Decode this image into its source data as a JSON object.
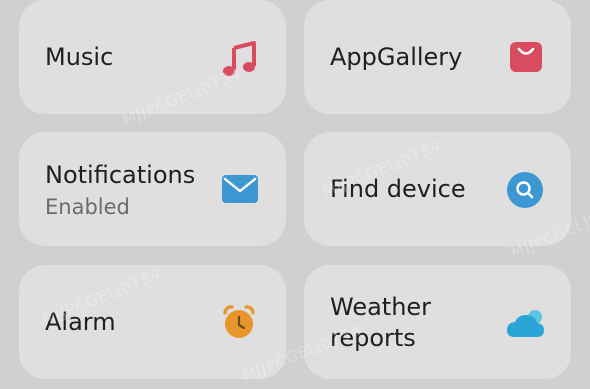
{
  "watermark_text": "MJJPCGELJb754",
  "tiles": {
    "music": {
      "label": "Music",
      "icon": "music-note-icon",
      "color": "#d94c5f"
    },
    "appgallery": {
      "label": "AppGallery",
      "icon": "shopping-bag-icon",
      "color": "#d94c5f"
    },
    "notifications": {
      "label": "Notifications",
      "status": "Enabled",
      "icon": "envelope-icon",
      "color": "#3d97d3"
    },
    "find_device": {
      "label": "Find device",
      "icon": "search-icon",
      "color": "#3d97d3"
    },
    "alarm": {
      "label": "Alarm",
      "icon": "alarm-clock-icon",
      "color": "#e8962b"
    },
    "weather": {
      "label_line1": "Weather",
      "label_line2": "reports",
      "icon": "weather-cloud-icon",
      "color": "#2aa5d6"
    }
  }
}
